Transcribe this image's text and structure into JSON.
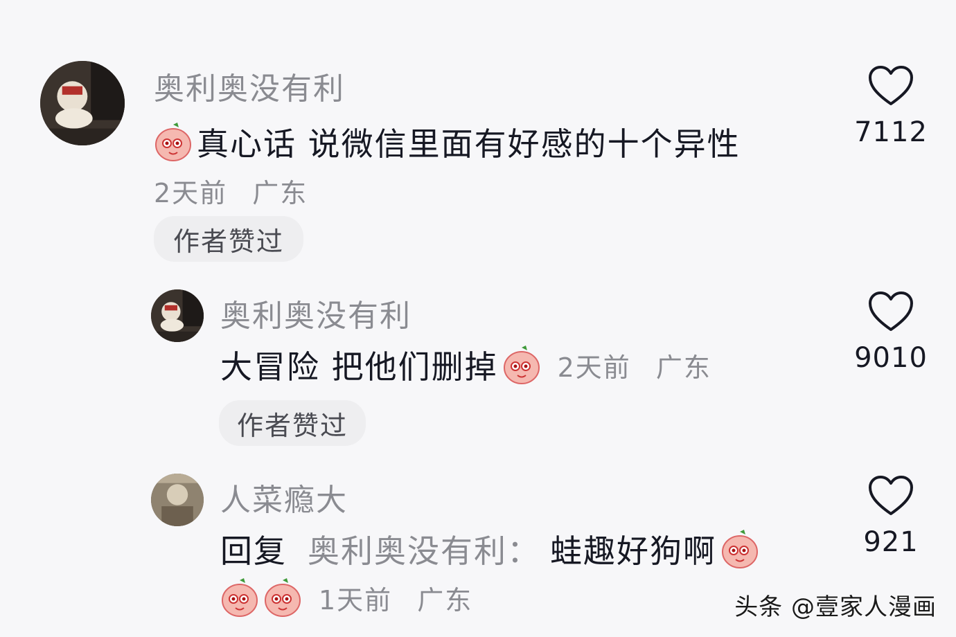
{
  "comments": [
    {
      "username": "奥利奥没有利",
      "text": "真心话 说微信里面有好感的十个异性",
      "time": "2天前",
      "location": "广东",
      "badge": "作者赞过",
      "likes": "7112"
    },
    {
      "username": "奥利奥没有利",
      "text": "大冒险 把他们删掉",
      "time": "2天前",
      "location": "广东",
      "badge": "作者赞过",
      "likes": "9010"
    },
    {
      "username": "人菜瘾大",
      "reply_label": "回复",
      "reply_to": "奥利奥没有利：",
      "text": "蛙趣好狗啊",
      "time": "1天前",
      "location": "广东",
      "likes": "921"
    }
  ],
  "watermark": "头条 @壹家人漫画",
  "icons": {
    "like": "heart-outline-icon",
    "emoji": "peach-face-emoji-icon"
  },
  "colors": {
    "primary_text": "#161823",
    "secondary_text": "#8a8b91",
    "badge_bg": "#eeeef0",
    "background": "#f7f7f9"
  }
}
